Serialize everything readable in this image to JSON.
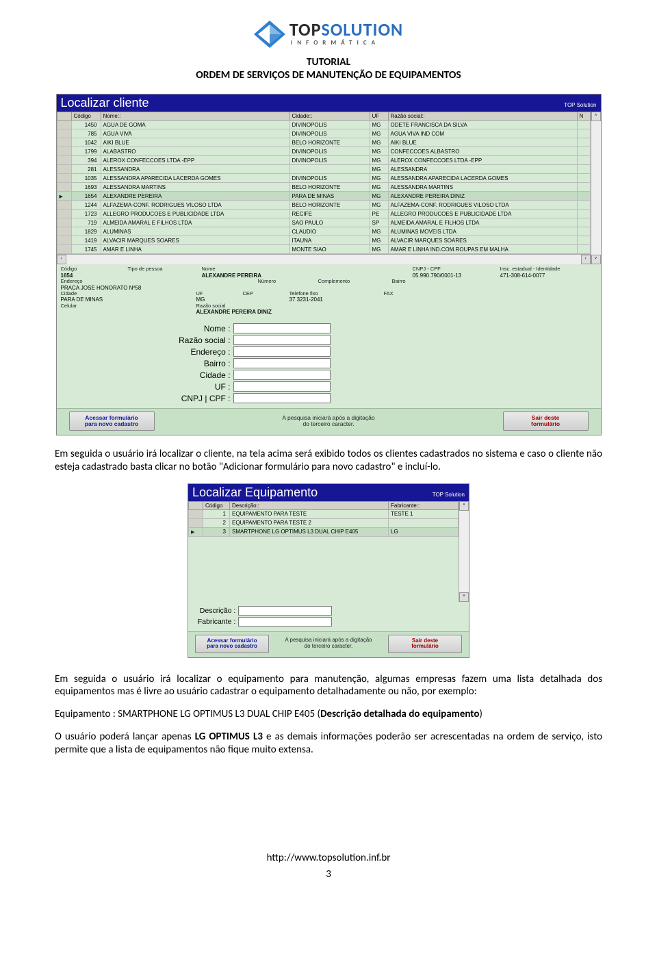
{
  "logo": {
    "brand1": "TOP",
    "brand2": "SOLUTION",
    "sub": "INFORMÁTICA"
  },
  "doc_title_l1": "TUTORIAL",
  "doc_title_l2": "ORDEM DE SERVIÇOS DE MANUTENÇÃO DE EQUIPAMENTOS",
  "dlg1": {
    "title": "Localizar cliente",
    "tag": "TOP Solution",
    "cols": {
      "c1": "Código",
      "c2": "Nome::",
      "c3": "Cidade::",
      "c4": "UF",
      "c5": "Razão social::",
      "c6": "N"
    },
    "rows": [
      {
        "cod": "1450",
        "nome": "AGUA DE GOMA",
        "cidade": "DIVINOPOLIS",
        "uf": "MG",
        "razao": "ODETE FRANCISCA DA SILVA"
      },
      {
        "cod": "785",
        "nome": "AGUA VIVA",
        "cidade": "DIVINOPOLIS",
        "uf": "MG",
        "razao": "AGUA VIVA IND COM"
      },
      {
        "cod": "1042",
        "nome": "AIKI BLUE",
        "cidade": "BELO HORIZONTE",
        "uf": "MG",
        "razao": "AIKI BLUE"
      },
      {
        "cod": "1799",
        "nome": "ALABASTRO",
        "cidade": "DIVINOPOLIS",
        "uf": "MG",
        "razao": "CONFECCOES ALBASTRO"
      },
      {
        "cod": "394",
        "nome": "ALEROX CONFECCOES LTDA -EPP",
        "cidade": "DIVINOPOLIS",
        "uf": "MG",
        "razao": "ALEROX CONFECCOES LTDA -EPP"
      },
      {
        "cod": "281",
        "nome": "ALESSANDRA",
        "cidade": "",
        "uf": "MG",
        "razao": "ALESSANDRA"
      },
      {
        "cod": "1035",
        "nome": "ALESSANDRA APARECIDA LACERDA GOMES",
        "cidade": "DIVINOPOLIS",
        "uf": "MG",
        "razao": "ALESSANDRA APARECIDA LACERDA GOMES"
      },
      {
        "cod": "1693",
        "nome": "ALESSANDRA MARTINS",
        "cidade": "BELO HORIZONTE",
        "uf": "MG",
        "razao": "ALESSANDRA MARTINS"
      },
      {
        "cod": "1654",
        "nome": "ALEXANDRE PEREIRA",
        "cidade": "PARA DE MINAS",
        "uf": "MG",
        "razao": "ALEXANDRE PEREIRA DINIZ",
        "sel": true
      },
      {
        "cod": "1244",
        "nome": "ALFAZEMA-CONF. RODRIGUES VILOSO LTDA",
        "cidade": "BELO HORIZONTE",
        "uf": "MG",
        "razao": "ALFAZEMA-CONF. RODRIGUES VILOSO LTDA"
      },
      {
        "cod": "1723",
        "nome": "ALLEGRO PRODUCOES E PUBLICIDADE LTDA",
        "cidade": "RECIFE",
        "uf": "PE",
        "razao": "ALLEGRO PRODUCOES E PUBLICIDADE LTDA"
      },
      {
        "cod": "719",
        "nome": "ALMEIDA AMARAL E FILHOS LTDA",
        "cidade": "SAO PAULO",
        "uf": "SP",
        "razao": "ALMEIDA AMARAL E FILHOS LTDA"
      },
      {
        "cod": "1829",
        "nome": "ALUMINAS",
        "cidade": "CLAUDIO",
        "uf": "MG",
        "razao": "ALUMINAS MOVEIS LTDA"
      },
      {
        "cod": "1419",
        "nome": "ALVACIR MARQUES SOARES",
        "cidade": "ITAUNA",
        "uf": "MG",
        "razao": "ALVACIR MARQUES SOARES"
      },
      {
        "cod": "1745",
        "nome": "AMAR E LINHA",
        "cidade": "MONTE SIAO",
        "uf": "MG",
        "razao": "AMAR E LINHA IND.COM.ROUPAS EM MALHA"
      }
    ],
    "detail": {
      "codigo_l": "Código",
      "tipo_l": "Tipo de pessoa",
      "nome_l": "Nome",
      "cnpj_l": "CNPJ - CPF",
      "insc_l": "Insc. estadual - Identidade",
      "codigo": "1654",
      "nome": "ALEXANDRE PEREIRA",
      "cnpj": "05.990.790/0001-13",
      "insc": "471-308-614-0077",
      "end_l": "Endereço",
      "num_l": "Número",
      "compl_l": "Complemento",
      "bairro_l": "Bairro",
      "endereco": "PRACA JOSE HONORATO Nº58",
      "cidade_l": "Cidade",
      "uf_l": "UF",
      "cep_l": "CEP",
      "tel_l": "Telefone fixo",
      "fax_l": "FAX",
      "cidade": "PARA DE MINAS",
      "uf": "MG",
      "tel": "37 3231-2041",
      "cel_l": "Celular",
      "razao_l": "Razão social",
      "razao": "ALEXANDRE PEREIRA DINIZ"
    },
    "search_labels": [
      "Nome :",
      "Razão social :",
      "Endereço :",
      "Bairro :",
      "Cidade :",
      "UF :",
      "CNPJ | CPF :"
    ],
    "btn_left_l1": "Acessar formulário",
    "btn_left_l2": "para novo cadastro",
    "hint": "A pesquisa iniciará após a digitação\ndo terceiro caracter.",
    "btn_right_l1": "Sair deste",
    "btn_right_l2": "formulário"
  },
  "para1": "Em seguida o usuário irá localizar o cliente, na tela acima será exibido todos os clientes cadastrados no sistema e caso o cliente não esteja cadastrado basta clicar no botão \"Adicionar formulário para novo cadastro\" e incluí-lo.",
  "dlg2": {
    "title": "Localizar Equipamento",
    "tag": "TOP Solution",
    "cols": {
      "c1": "Código",
      "c2": "Descrição::",
      "c3": "Fabricante::"
    },
    "rows": [
      {
        "cod": "1",
        "desc": "EQUIPAMENTO PARA TESTE",
        "fab": "TESTE 1"
      },
      {
        "cod": "2",
        "desc": "EQUIPAMENTO PARA TESTE 2",
        "fab": ""
      },
      {
        "cod": "3",
        "desc": "SMARTPHONE LG OPTIMUS L3 DUAL CHIP E405",
        "fab": "LG",
        "sel": true
      }
    ],
    "search_labels": [
      "Descrição :",
      "Fabricante :"
    ],
    "btn_left_l1": "Acessar formulário",
    "btn_left_l2": "para novo cadastro",
    "hint": "A pesquisa iniciará após a digitação\ndo terceiro caracter.",
    "btn_right_l1": "Sair deste",
    "btn_right_l2": "formulário"
  },
  "para2": "Em seguida o usuário irá localizar o equipamento para manutenção, algumas empresas fazem uma lista detalhada dos equipamentos mas é livre ao usuário cadastrar o equipamento detalhadamente ou não, por exemplo:",
  "para3_a": "Equipamento : SMARTPHONE LG OPTIMUS L3 DUAL CHIP E405 (",
  "para3_b": "Descrição detalhada do equipamento",
  "para3_c": ")",
  "para4_a": "O usuário poderá lançar apenas ",
  "para4_b": "LG OPTIMUS L3 ",
  "para4_c": "e as demais informações poderão ser acrescentadas na ordem de serviço, isto permite que a lista de equipamentos não fique muito extensa.",
  "footer_url": "http://www.topsolution.inf.br",
  "pagenum": "3"
}
